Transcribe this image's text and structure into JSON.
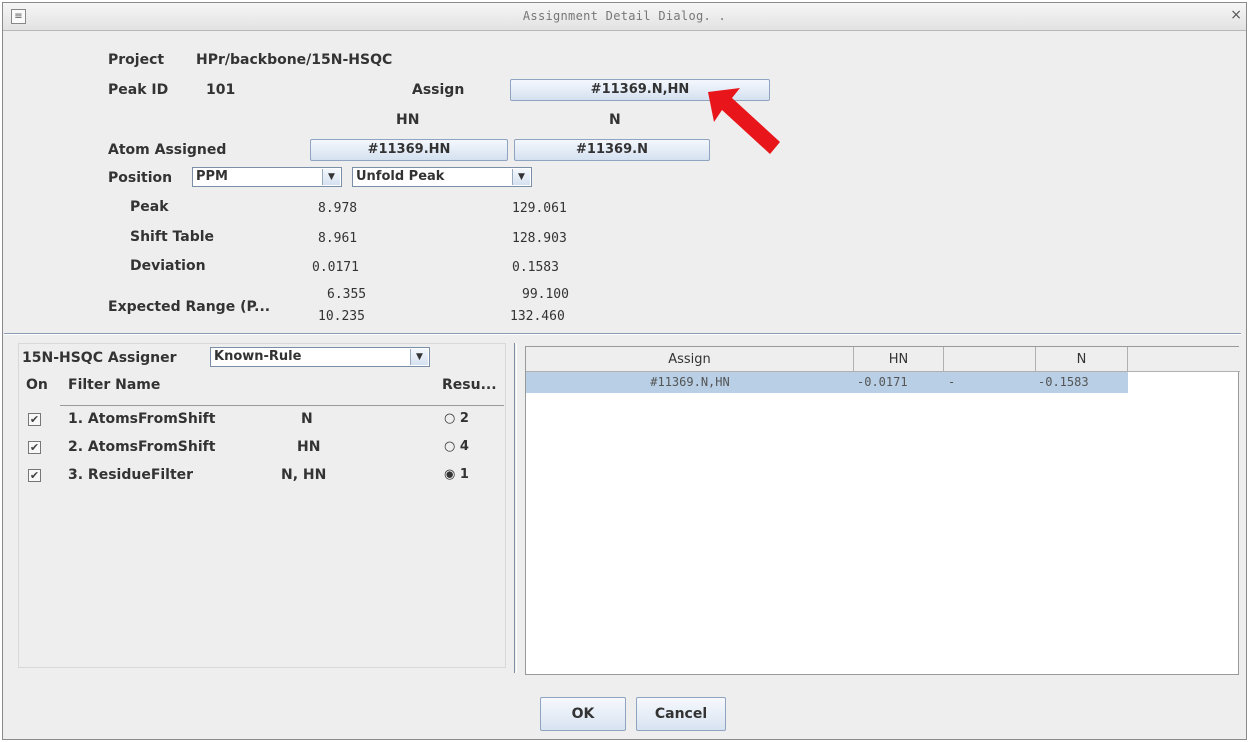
{
  "window": {
    "title": "Assignment Detail Dialog. .",
    "close_glyph": "×",
    "icon_glyph": "≡"
  },
  "details": {
    "project_label": "Project",
    "project_value": "HPr/backbone/15N-HSQC",
    "peak_id_label": "Peak ID",
    "peak_id_value": "101",
    "assign_label": "Assign",
    "assign_button": "#11369.N,HN",
    "col_hn": "HN",
    "col_n": "N",
    "atom_assigned_label": "Atom Assigned",
    "atom_hn_button": "#11369.HN",
    "atom_n_button": "#11369.N",
    "position_label": "Position",
    "position_unit": "PPM",
    "peak_mode": "Unfold Peak",
    "combo_arrow": "▼",
    "rows": [
      {
        "label": "Peak",
        "hn": "8.978",
        "n": "129.061"
      },
      {
        "label": "Shift Table",
        "hn": "8.961",
        "n": "128.903"
      },
      {
        "label": "Deviation",
        "hn": "0.0171",
        "n": "0.1583"
      }
    ],
    "expected_label": "Expected Range (P...",
    "expected_hn_low": "6.355",
    "expected_hn_high": "10.235",
    "expected_n_low": "99.100",
    "expected_n_high": "132.460"
  },
  "assigner": {
    "label": "15N-HSQC Assigner",
    "rule": "Known-Rule",
    "col_on": "On",
    "col_filter": "Filter Name",
    "col_result": "Resu...",
    "check_glyph": "✔",
    "filters": [
      {
        "name": "1. AtomsFromShift",
        "atoms": "N",
        "result": "2",
        "radio": "○",
        "checked": true
      },
      {
        "name": "2. AtomsFromShift",
        "atoms": "HN",
        "result": "4",
        "radio": "○",
        "checked": true
      },
      {
        "name": "3. ResidueFilter",
        "atoms": "N, HN",
        "result": "1",
        "radio": "◉",
        "checked": true
      }
    ]
  },
  "results_table": {
    "headers": [
      "Assign",
      "HN",
      "",
      "N"
    ],
    "rows": [
      {
        "assign": "#11369.N,HN",
        "hn": "-0.0171",
        "mid": "-",
        "n": "-0.1583"
      }
    ]
  },
  "footer": {
    "ok": "OK",
    "cancel": "Cancel"
  },
  "colors": {
    "arrow": "#e8151b",
    "selection": "#b8cfe5"
  }
}
